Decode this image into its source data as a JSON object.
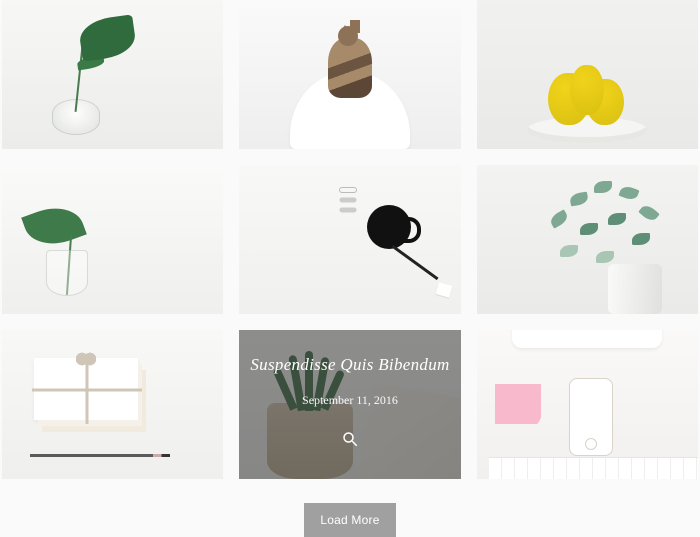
{
  "grid": {
    "items": [
      {
        "name": "gallery-item-monstera-vase"
      },
      {
        "name": "gallery-item-cat-chair"
      },
      {
        "name": "gallery-item-yellow-cactus"
      },
      {
        "name": "gallery-item-leaf-vase"
      },
      {
        "name": "gallery-item-black-mug"
      },
      {
        "name": "gallery-item-eucalyptus"
      },
      {
        "name": "gallery-item-envelopes"
      },
      {
        "name": "gallery-item-aloe-pot"
      },
      {
        "name": "gallery-item-phone-desk"
      }
    ]
  },
  "hovered": {
    "index": 7,
    "title": "Suspendisse Quis Bibendum",
    "date": "September 11, 2016",
    "action_icon": "search-icon"
  },
  "controls": {
    "load_more_label": "Load More"
  },
  "colors": {
    "overlay": "rgba(55,55,55,0.55)",
    "button_bg": "#a0a0a0",
    "button_fg": "#ffffff"
  }
}
